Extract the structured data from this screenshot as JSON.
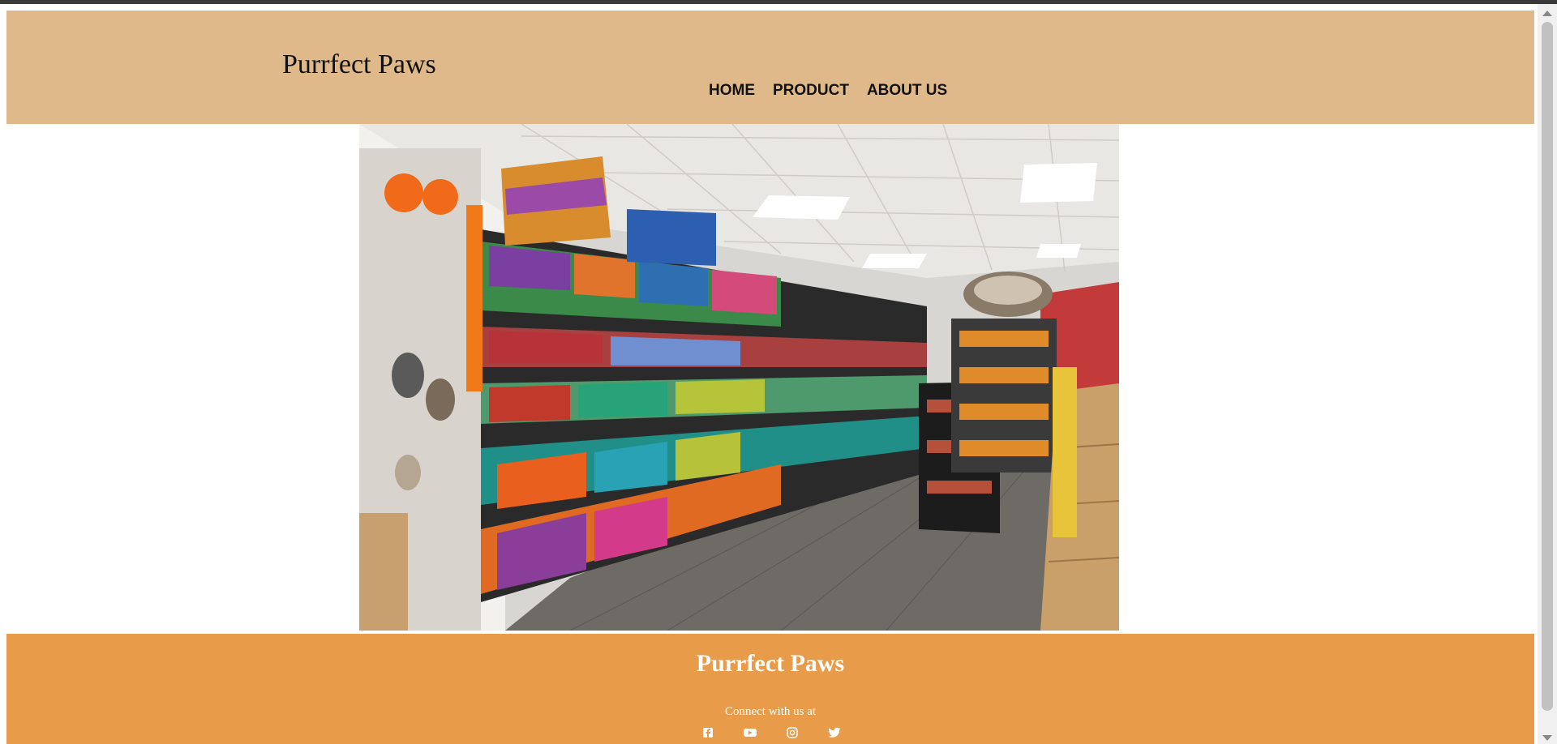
{
  "header": {
    "brand": "Purrfect Paws",
    "nav": [
      "HOME",
      "PRODUCT",
      "ABOUT US"
    ]
  },
  "hero": {
    "image_description": "pet-store-aisle-photo"
  },
  "footer": {
    "title": "Purrfect Paws",
    "connect_text": "Connect with us at",
    "socials": [
      "facebook-icon",
      "youtube-icon",
      "instagram-icon",
      "twitter-icon"
    ]
  },
  "colors": {
    "header_bg": "#e0b98b",
    "footer_bg": "#e89b48",
    "text_dark": "#111111",
    "text_light": "#ffffff"
  }
}
